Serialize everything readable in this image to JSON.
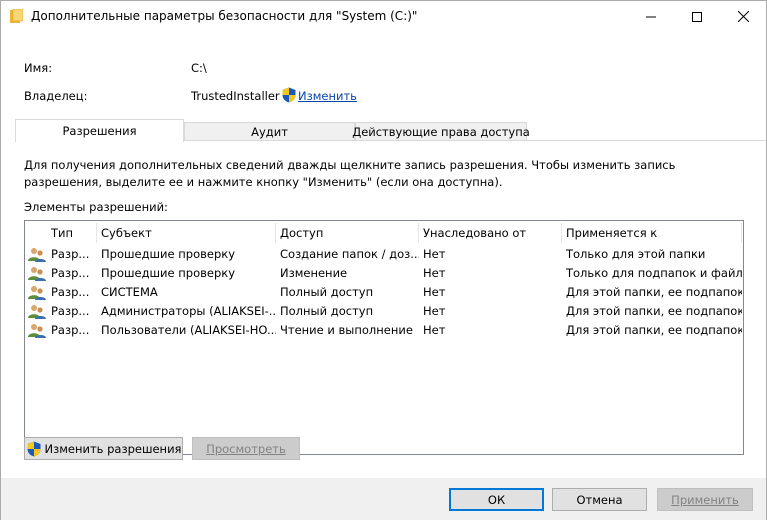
{
  "window": {
    "title": "Дополнительные параметры безопасности  для \"System (C:)\""
  },
  "info": {
    "name_label": "Имя:",
    "name_value": "C:\\",
    "owner_label": "Владелец:",
    "owner_value": "TrustedInstaller",
    "change_link": "Изменить"
  },
  "tabs": [
    {
      "label": "Разрешения",
      "active": true
    },
    {
      "label": "Аудит",
      "active": false
    },
    {
      "label": "Действующие права доступа",
      "active": false
    }
  ],
  "permissions": {
    "description": "Для получения дополнительных сведений дважды щелкните запись разрешения. Чтобы изменить запись разрешения, выделите ее и нажмите кнопку \"Изменить\" (если она доступна).",
    "list_label": "Элементы разрешений:",
    "columns": [
      "Тип",
      "Субъект",
      "Доступ",
      "Унаследовано от",
      "Применяется к"
    ],
    "rows": [
      [
        "Разр...",
        "Прошедшие проверку",
        "Создание папок / доз...",
        "Нет",
        "Только для этой папки"
      ],
      [
        "Разр...",
        "Прошедшие проверку",
        "Изменение",
        "Нет",
        "Только для подпапок и файл..."
      ],
      [
        "Разр...",
        "СИСТЕМА",
        "Полный доступ",
        "Нет",
        "Для этой папки, ее подпапок ..."
      ],
      [
        "Разр...",
        "Администраторы (ALIAKSEI-...",
        "Полный доступ",
        "Нет",
        "Для этой папки, ее подпапок ..."
      ],
      [
        "Разр...",
        "Пользователи (ALIAKSEI-HO...",
        "Чтение и выполнение",
        "Нет",
        "Для этой папки, ее подпапок ..."
      ]
    ],
    "change_permissions_button": "Изменить разрешения",
    "view_button": "Просмотреть"
  },
  "footer": {
    "ok": "ОК",
    "cancel": "Отмена",
    "apply": "Применить"
  },
  "colors": {
    "accent": "#0078d7",
    "link": "#0645ad"
  }
}
